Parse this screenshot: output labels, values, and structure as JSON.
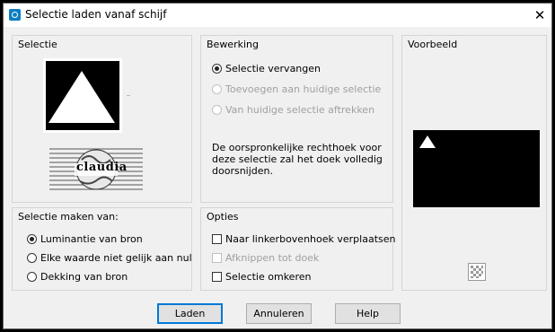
{
  "window": {
    "title": "Selectie laden vanaf schijf",
    "close_glyph": "✕"
  },
  "selectie": {
    "label": "Selectie",
    "watermark_text": "claudia"
  },
  "bewerking": {
    "label": "Bewerking",
    "options": [
      {
        "label": "Selectie vervangen",
        "selected": true,
        "enabled": true
      },
      {
        "label": "Toevoegen aan huidige selectie",
        "selected": false,
        "enabled": false
      },
      {
        "label": "Van huidige selectie aftrekken",
        "selected": false,
        "enabled": false
      }
    ],
    "description": "De oorspronkelijke rechthoek voor deze selectie zal het doek volledig doorsnijden."
  },
  "voorbeeld": {
    "label": "Voorbeeld"
  },
  "selectie_maken": {
    "label": "Selectie maken van:",
    "options": [
      {
        "label": "Luminantie van bron",
        "selected": true
      },
      {
        "label": "Elke waarde niet gelijk aan nul",
        "selected": false
      },
      {
        "label": "Dekking van bron",
        "selected": false
      }
    ]
  },
  "opties": {
    "label": "Opties",
    "items": [
      {
        "label": "Naar linkerbovenhoek verplaatsen",
        "checked": false,
        "enabled": true
      },
      {
        "label": "Afknippen tot doek",
        "checked": false,
        "enabled": false
      },
      {
        "label": "Selectie omkeren",
        "checked": false,
        "enabled": true
      }
    ]
  },
  "buttons": {
    "load": "Laden",
    "cancel": "Annuleren",
    "help": "Help"
  },
  "colors": {
    "accent": "#0078d7",
    "icon_blue": "#0d7fc2"
  }
}
